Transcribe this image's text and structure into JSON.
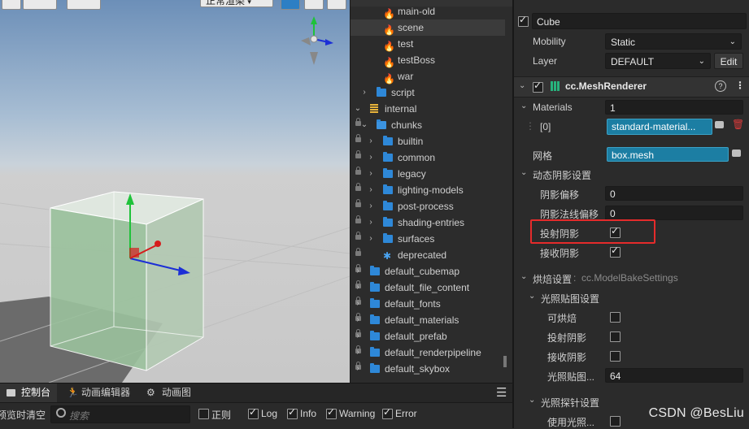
{
  "scene": {
    "toolbar_dropdown": "正常渲染"
  },
  "hierarchy": {
    "rows": [
      {
        "label": "main-old",
        "kind": "scene"
      },
      {
        "label": "scene",
        "kind": "scene",
        "selected": true
      },
      {
        "label": "test",
        "kind": "scene"
      },
      {
        "label": "testBoss",
        "kind": "scene"
      },
      {
        "label": "war",
        "kind": "scene"
      },
      {
        "label": "script",
        "kind": "folder"
      },
      {
        "label": "internal",
        "kind": "db"
      },
      {
        "label": "chunks",
        "kind": "folder-open"
      },
      {
        "label": "builtin",
        "kind": "folder"
      },
      {
        "label": "common",
        "kind": "folder"
      },
      {
        "label": "legacy",
        "kind": "folder"
      },
      {
        "label": "lighting-models",
        "kind": "folder"
      },
      {
        "label": "post-process",
        "kind": "folder"
      },
      {
        "label": "shading-entries",
        "kind": "folder"
      },
      {
        "label": "surfaces",
        "kind": "folder"
      },
      {
        "label": "deprecated",
        "kind": "asset"
      },
      {
        "label": "default_cubemap",
        "kind": "folder"
      },
      {
        "label": "default_file_content",
        "kind": "folder"
      },
      {
        "label": "default_fonts",
        "kind": "folder"
      },
      {
        "label": "default_materials",
        "kind": "folder"
      },
      {
        "label": "default_prefab",
        "kind": "folder"
      },
      {
        "label": "default_renderpipeline",
        "kind": "folder"
      },
      {
        "label": "default_skybox",
        "kind": "folder"
      }
    ]
  },
  "inspector": {
    "node_name": "Cube",
    "mobility_label": "Mobility",
    "mobility_value": "Static",
    "layer_label": "Layer",
    "layer_value": "DEFAULT",
    "edit_label": "Edit",
    "component_title": "cc.MeshRenderer",
    "materials_label": "Materials",
    "materials_count": "1",
    "material_index": "[0]",
    "material_value": "standard-material...",
    "mesh_label": "网格",
    "mesh_value": "box.mesh",
    "dynamic_shadow_label": "动态阴影设置",
    "shadow_bias_label": "阴影偏移",
    "shadow_bias_value": "0",
    "shadow_normal_bias_label": "阴影法线偏移",
    "shadow_normal_bias_value": "0",
    "cast_shadow_label": "投射阴影",
    "receive_shadow_label": "接收阴影",
    "bake_label": "烘焙设置",
    "bake_type": "cc.ModelBakeSettings",
    "lightmap_label": "光照贴图设置",
    "bakeable_label": "可烘焙",
    "cast_shadow2_label": "投射阴影",
    "receive_shadow2_label": "接收阴影",
    "lightmap_size_label": "光照贴图...",
    "lightmap_size_value": "64",
    "probe_label": "光照探针设置",
    "use_probe_label": "使用光照...",
    "watermark": "CSDN @BesLiu"
  },
  "console": {
    "tabs": [
      "控制台",
      "动画编辑器",
      "动画图"
    ],
    "clear_on_preview": "预览时清空",
    "search_placeholder": "搜索",
    "filters": [
      {
        "label": "正则",
        "checked": false
      },
      {
        "label": "Log",
        "checked": true
      },
      {
        "label": "Info",
        "checked": true
      },
      {
        "label": "Warning",
        "checked": true
      },
      {
        "label": "Error",
        "checked": true
      }
    ]
  }
}
